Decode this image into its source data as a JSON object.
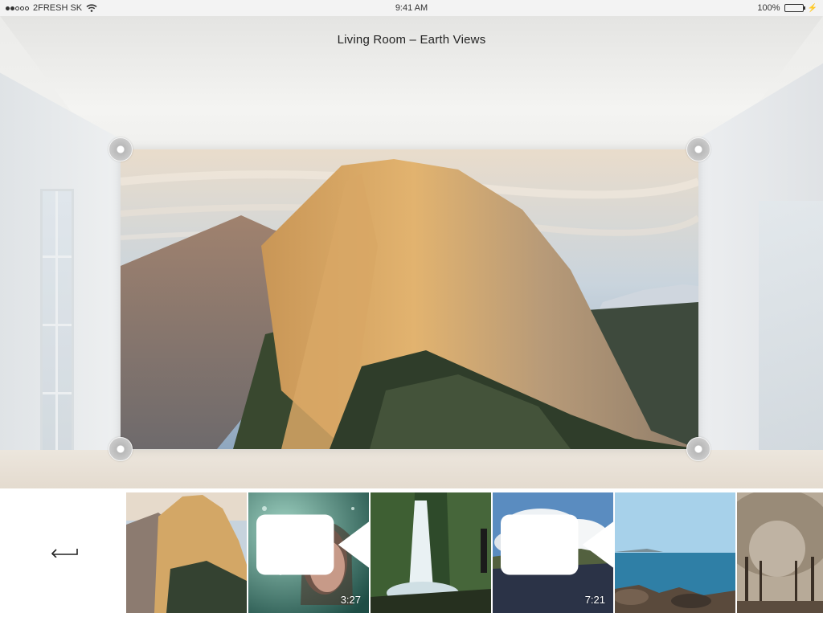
{
  "status_bar": {
    "carrier": "2FRESH SK",
    "time": "9:41 AM",
    "battery": "100%",
    "signal_icon": "signal-dots-icon",
    "wifi_icon": "wifi-icon",
    "battery_icon": "battery-icon"
  },
  "header": {
    "title": "Living Room – Earth Views"
  },
  "preview": {
    "image": "half-dome-mountain-photo"
  },
  "strip": {
    "back_icon": "back-arrow-icon",
    "thumbnails": [
      {
        "name": "half-dome",
        "is_video": false,
        "duration": ""
      },
      {
        "name": "woman-behind-rainy-glass",
        "is_video": true,
        "duration": "3:27"
      },
      {
        "name": "waterfall",
        "is_video": false,
        "duration": ""
      },
      {
        "name": "clouds-over-field",
        "is_video": true,
        "duration": "7:21"
      },
      {
        "name": "ocean-coast",
        "is_video": false,
        "duration": ""
      },
      {
        "name": "tree-avenue",
        "is_video": false,
        "duration": ""
      }
    ]
  },
  "colors": {
    "accent": "#222222",
    "status_bar_bg": "#f3f3f3"
  }
}
